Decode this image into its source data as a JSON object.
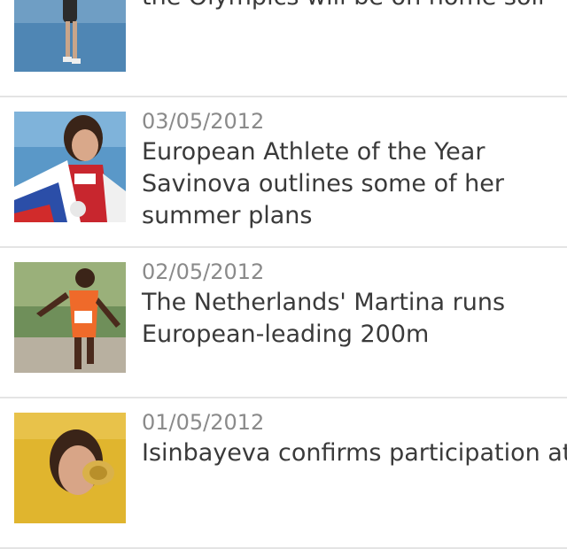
{
  "articles": [
    {
      "date": "",
      "headline_lines": [
        "the Olympics will be on home soil"
      ],
      "image": "runner-track-photo"
    },
    {
      "date": "03/05/2012",
      "headline_lines": [
        "European Athlete of the Year",
        "Savinova outlines some of her",
        "summer plans"
      ],
      "image": "athlete-flag-photo"
    },
    {
      "date": "02/05/2012",
      "headline_lines": [
        "The Netherlands' Martina runs",
        "European-leading 200m"
      ],
      "image": "sprinter-photo"
    },
    {
      "date": "01/05/2012",
      "headline_lines": [
        "Isinbayeva confirms participation at",
        ""
      ],
      "image": "polevaulter-medal-photo"
    }
  ]
}
